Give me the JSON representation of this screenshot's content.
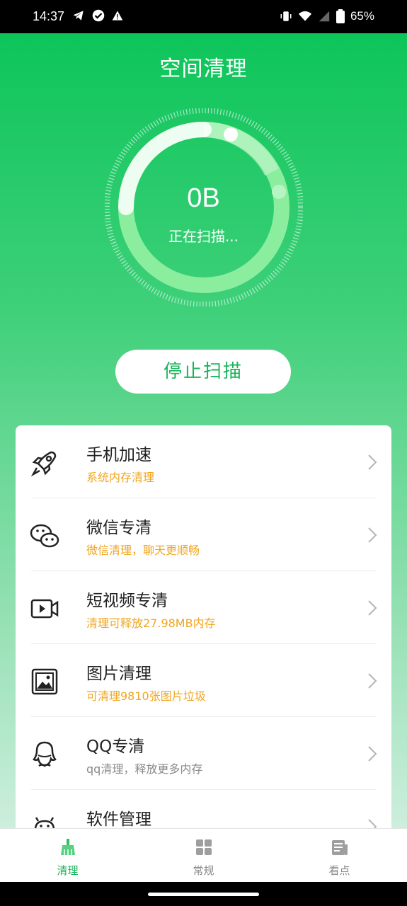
{
  "status_bar": {
    "time": "14:37",
    "battery": "65%",
    "left_icons": [
      "telegram-icon",
      "check-circle-icon",
      "warning-icon"
    ],
    "right_icons": [
      "vibrate-icon",
      "wifi-icon",
      "signal-icon",
      "battery-icon"
    ]
  },
  "header": {
    "title": "空间清理"
  },
  "scan": {
    "size": "0B",
    "status": "正在扫描...",
    "stop_label": "停止扫描"
  },
  "features": [
    {
      "name": "手机加速",
      "desc": "系统内存清理",
      "icon": "rocket-icon"
    },
    {
      "name": "微信专清",
      "desc": "微信清理，聊天更顺畅",
      "icon": "wechat-icon"
    },
    {
      "name": "短视频专清",
      "desc": "清理可释放27.98MB内存",
      "icon": "video-icon"
    },
    {
      "name": "图片清理",
      "desc": "可清理9810张图片垃圾",
      "icon": "image-icon"
    },
    {
      "name": "QQ专清",
      "desc": "qq清理，释放更多内存",
      "icon": "qq-icon"
    },
    {
      "name": "软件管理",
      "desc": "",
      "icon": "android-icon"
    }
  ],
  "bottom_nav": [
    {
      "label": "清理",
      "icon": "broom-icon",
      "active": true
    },
    {
      "label": "常规",
      "icon": "grid-icon",
      "active": false
    },
    {
      "label": "看点",
      "icon": "news-icon",
      "active": false
    }
  ],
  "colors": {
    "brand_green": "#19b45a",
    "hero_top": "#0dc55a",
    "desc_orange": "#f0a623"
  }
}
